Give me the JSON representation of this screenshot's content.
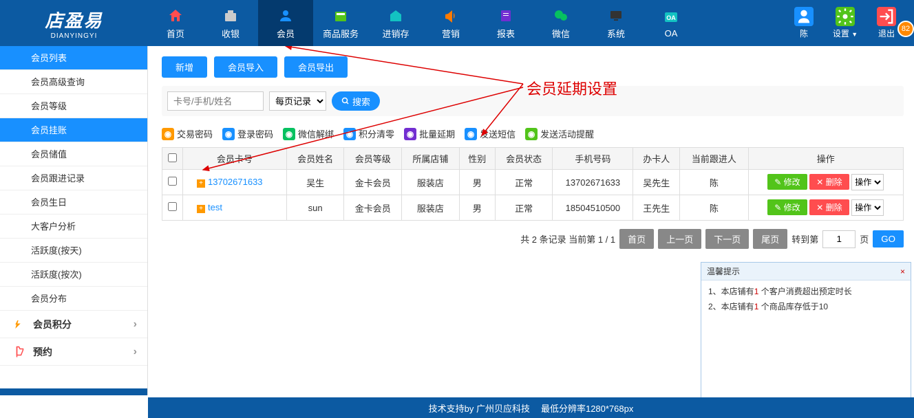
{
  "logo": {
    "title": "店盈易",
    "sub": "DIANYINGYI"
  },
  "nav": [
    {
      "label": "首页",
      "color": "#ff4d4f"
    },
    {
      "label": "收银",
      "color": "#555"
    },
    {
      "label": "会员",
      "color": "#1890ff",
      "active": true
    },
    {
      "label": "商品服务",
      "color": "#52c41a"
    },
    {
      "label": "进销存",
      "color": "#13c2c2"
    },
    {
      "label": "营销",
      "color": "#ff7a00"
    },
    {
      "label": "报表",
      "color": "#722ed1"
    },
    {
      "label": "微信",
      "color": "#07c160"
    },
    {
      "label": "系统",
      "color": "#333"
    },
    {
      "label": "OA",
      "color": "#13c2c2"
    }
  ],
  "header_right": [
    {
      "label": "陈",
      "color": "#1890ff"
    },
    {
      "label": "设置",
      "color": "#52c41a"
    },
    {
      "label": "退出",
      "color": "#ff4d4f"
    }
  ],
  "badge_count": "82",
  "sidebar": {
    "items": [
      {
        "label": "会员列表",
        "active": true
      },
      {
        "label": "会员高级查询"
      },
      {
        "label": "会员等级"
      },
      {
        "label": "会员挂账",
        "active": true
      },
      {
        "label": "会员储值"
      },
      {
        "label": "会员跟进记录"
      },
      {
        "label": "会员生日"
      },
      {
        "label": "大客户分析"
      },
      {
        "label": "活跃度(按天)"
      },
      {
        "label": "活跃度(按次)"
      },
      {
        "label": "会员分布"
      }
    ],
    "groups": [
      {
        "label": "会员积分",
        "color": "#ff9900"
      },
      {
        "label": "预约",
        "color": "#ff4d4f"
      }
    ]
  },
  "toolbar": {
    "new": "新增",
    "import": "会员导入",
    "export": "会员导出"
  },
  "search": {
    "placeholder": "卡号/手机/姓名",
    "records_label": "每页记录",
    "search_label": "搜索"
  },
  "actions": [
    {
      "label": "交易密码",
      "color": "#ff9900"
    },
    {
      "label": "登录密码",
      "color": "#1890ff"
    },
    {
      "label": "微信解绑",
      "color": "#07c160"
    },
    {
      "label": "积分清零",
      "color": "#1890ff"
    },
    {
      "label": "批量延期",
      "color": "#722ed1"
    },
    {
      "label": "发送短信",
      "color": "#1890ff"
    },
    {
      "label": "发送活动提醒",
      "color": "#52c41a"
    }
  ],
  "table": {
    "headers": [
      "",
      "会员卡号",
      "会员姓名",
      "会员等级",
      "所属店铺",
      "性别",
      "会员状态",
      "手机号码",
      "办卡人",
      "当前跟进人",
      "操作"
    ],
    "rows": [
      {
        "card": "13702671633",
        "name": "吴生",
        "level": "金卡会员",
        "store": "服装店",
        "gender": "男",
        "status": "正常",
        "phone": "13702671633",
        "creator": "吴先生",
        "follower": "陈"
      },
      {
        "card": "test",
        "name": "sun",
        "level": "金卡会员",
        "store": "服装店",
        "gender": "男",
        "status": "正常",
        "phone": "18504510500",
        "creator": "王先生",
        "follower": "陈"
      }
    ],
    "edit_label": "修改",
    "delete_label": "删除",
    "op_select": "操作"
  },
  "pager": {
    "summary": "共 2 条记录 当前第 1 / 1",
    "first": "首页",
    "prev": "上一页",
    "next": "下一页",
    "last": "尾页",
    "goto_label": "转到第",
    "page_value": "1",
    "page_unit": "页",
    "go": "GO"
  },
  "annotation_text": "会员延期设置",
  "tips": {
    "title": "温馨提示",
    "lines": [
      {
        "prefix": "1、本店铺有",
        "count": "1",
        "suffix": " 个客户消费超出预定时长"
      },
      {
        "prefix": "2、本店铺有",
        "count": "1",
        "suffix": " 个商品库存低于10"
      }
    ]
  },
  "footer": {
    "support": "技术支持by 广州贝应科技",
    "resolution": "最低分辨率1280*768px"
  }
}
